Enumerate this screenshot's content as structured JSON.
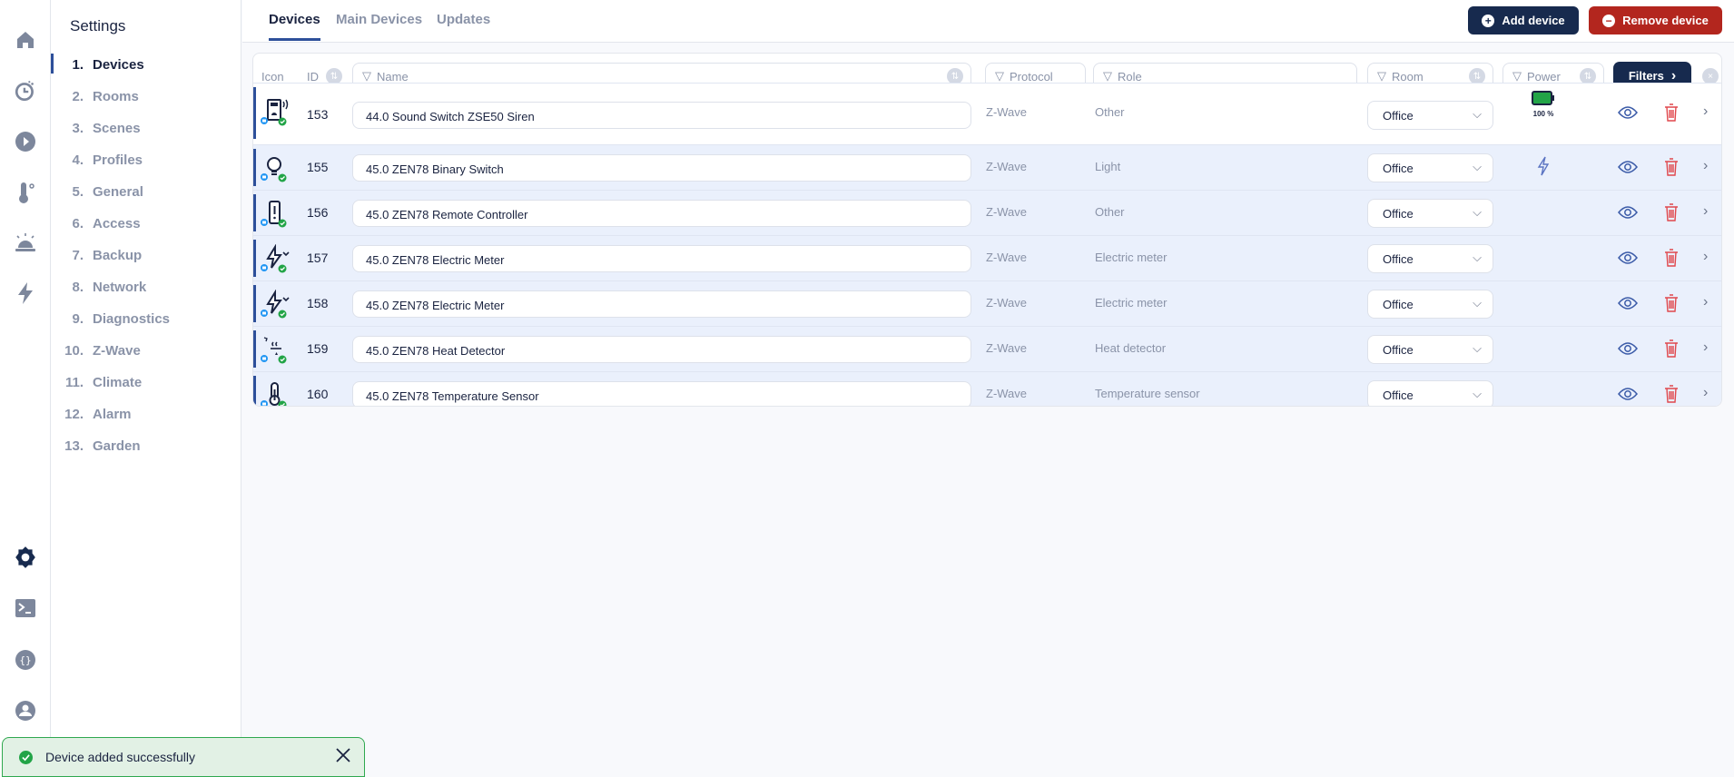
{
  "rail": {
    "top": [
      "home-icon",
      "history-icon",
      "play-icon",
      "thermometer-icon",
      "alarm-icon",
      "lightning-icon"
    ],
    "bottom": [
      "settings-icon",
      "terminal-icon",
      "api-icon",
      "support-icon"
    ]
  },
  "settings": {
    "title": "Settings",
    "items": [
      {
        "num": "1.",
        "label": "Devices"
      },
      {
        "num": "2.",
        "label": "Rooms"
      },
      {
        "num": "3.",
        "label": "Scenes"
      },
      {
        "num": "4.",
        "label": "Profiles"
      },
      {
        "num": "5.",
        "label": "General"
      },
      {
        "num": "6.",
        "label": "Access"
      },
      {
        "num": "7.",
        "label": "Backup"
      },
      {
        "num": "8.",
        "label": "Network"
      },
      {
        "num": "9.",
        "label": "Diagnostics"
      },
      {
        "num": "10.",
        "label": "Z-Wave"
      },
      {
        "num": "11.",
        "label": "Climate"
      },
      {
        "num": "12.",
        "label": "Alarm"
      },
      {
        "num": "13.",
        "label": "Garden"
      }
    ]
  },
  "tabs": [
    "Devices",
    "Main Devices",
    "Updates"
  ],
  "actions": {
    "add": "Add device",
    "remove": "Remove device",
    "add_color": "#172a4e",
    "remove_color": "#b3261e"
  },
  "table": {
    "headers": {
      "icon": "Icon",
      "id": "ID",
      "name": "Name",
      "protocol": "Protocol",
      "role": "Role",
      "room": "Room",
      "power": "Power",
      "filters": "Filters"
    },
    "rows": [
      {
        "id": "153",
        "name": "44.0 Sound Switch ZSE50 Siren",
        "protocol": "Z-Wave",
        "role": "Other",
        "room": "Office",
        "power": "100 %",
        "icon": "siren"
      },
      {
        "id": "155",
        "name": "45.0 ZEN78 Binary Switch",
        "protocol": "Z-Wave",
        "role": "Light",
        "room": "Office",
        "power": "mains",
        "icon": "bulb"
      },
      {
        "id": "156",
        "name": "45.0 ZEN78 Remote Controller",
        "protocol": "Z-Wave",
        "role": "Other",
        "room": "Office",
        "icon": "remote"
      },
      {
        "id": "157",
        "name": "45.0 ZEN78 Electric Meter",
        "protocol": "Z-Wave",
        "role": "Electric meter",
        "room": "Office",
        "icon": "meter"
      },
      {
        "id": "158",
        "name": "45.0 ZEN78 Electric Meter",
        "protocol": "Z-Wave",
        "role": "Electric meter",
        "room": "Office",
        "icon": "meter"
      },
      {
        "id": "159",
        "name": "45.0 ZEN78 Heat Detector",
        "protocol": "Z-Wave",
        "role": "Heat detector",
        "room": "Office",
        "icon": "heat"
      },
      {
        "id": "160",
        "name": "45.0 ZEN78 Temperature Sensor",
        "protocol": "Z-Wave",
        "role": "Temperature sensor",
        "room": "Office",
        "icon": "temp"
      }
    ]
  },
  "toast": {
    "message": "Device added successfully"
  }
}
